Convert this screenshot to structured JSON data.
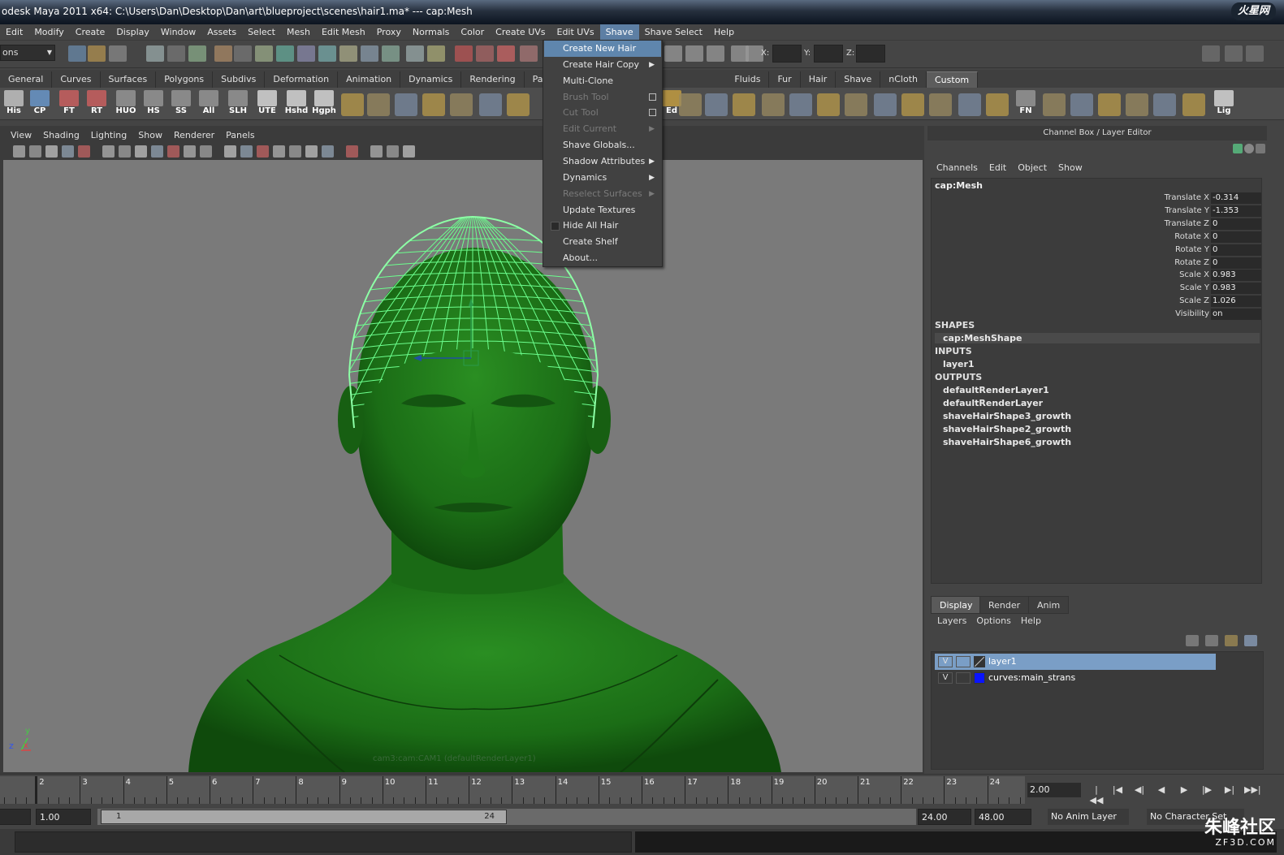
{
  "window": {
    "title": "odesk Maya 2011 x64: C:\\Users\\Dan\\Desktop\\Dan\\art\\blueproject\\scenes\\hair1.ma*  ---  cap:Mesh",
    "logo": "火星网"
  },
  "menubar": [
    "Edit",
    "Modify",
    "Create",
    "Display",
    "Window",
    "Assets",
    "Select",
    "Mesh",
    "Edit Mesh",
    "Proxy",
    "Normals",
    "Color",
    "Create UVs",
    "Edit UVs",
    "Shave",
    "Shave Select",
    "Help"
  ],
  "statusline": {
    "menuset": "ons",
    "x_label": "X:",
    "y_label": "Y:",
    "z_label": "Z:"
  },
  "shelf_tabs": [
    "General",
    "Curves",
    "Surfaces",
    "Polygons",
    "Subdivs",
    "Deformation",
    "Animation",
    "Dynamics",
    "Rendering",
    "PaintEff",
    "Fluids",
    "Fur",
    "Hair",
    "Shave",
    "nCloth",
    "Custom"
  ],
  "shelf_active_tab": "Custom",
  "shelf_labels": [
    "His",
    "CP",
    "FT",
    "RT",
    "HUO",
    "HS",
    "SS",
    "All",
    "SLH",
    "UTE",
    "Hshd",
    "Hgph",
    "Ed",
    "FN",
    "Lig"
  ],
  "shave_menu": {
    "items": [
      {
        "label": "Create New Hair",
        "state": "highlight"
      },
      {
        "label": "Create Hair Copy",
        "submenu": true
      },
      {
        "label": "Multi-Clone"
      },
      {
        "label": "Brush Tool",
        "state": "disabled",
        "option_box": true
      },
      {
        "label": "Cut Tool",
        "state": "disabled",
        "option_box": true
      },
      {
        "label": "Edit Current",
        "state": "disabled",
        "submenu": true
      },
      {
        "label": "Shave Globals..."
      },
      {
        "label": "Shadow Attributes",
        "submenu": true
      },
      {
        "label": "Dynamics",
        "submenu": true
      },
      {
        "label": "Reselect Surfaces",
        "state": "disabled",
        "submenu": true
      },
      {
        "label": "Update Textures"
      },
      {
        "label": "Hide All Hair",
        "checkbox": true
      },
      {
        "label": "Create Shelf"
      },
      {
        "label": "About..."
      }
    ]
  },
  "viewport": {
    "menu": [
      "View",
      "Shading",
      "Lighting",
      "Show",
      "Renderer",
      "Panels"
    ],
    "camera_caption": "cam3:cam:CAM1 (defaultRenderLayer1)",
    "axis_z": "z",
    "axis_x": "x",
    "axis_y": "y"
  },
  "channel_box": {
    "header": "Channel Box / Layer Editor",
    "menu": [
      "Channels",
      "Edit",
      "Object",
      "Show"
    ],
    "object": "cap:Mesh",
    "attributes": [
      {
        "name": "Translate X",
        "value": "-0.314"
      },
      {
        "name": "Translate Y",
        "value": "-1.353"
      },
      {
        "name": "Translate Z",
        "value": "0"
      },
      {
        "name": "Rotate X",
        "value": "0"
      },
      {
        "name": "Rotate Y",
        "value": "0"
      },
      {
        "name": "Rotate Z",
        "value": "0"
      },
      {
        "name": "Scale X",
        "value": "0.983"
      },
      {
        "name": "Scale Y",
        "value": "0.983"
      },
      {
        "name": "Scale Z",
        "value": "1.026"
      },
      {
        "name": "Visibility",
        "value": "on"
      }
    ],
    "shapes_label": "SHAPES",
    "shapes": [
      "cap:MeshShape"
    ],
    "inputs_label": "INPUTS",
    "inputs": [
      "layer1"
    ],
    "outputs_label": "OUTPUTS",
    "outputs": [
      "defaultRenderLayer1",
      "defaultRenderLayer",
      "shaveHairShape3_growth",
      "shaveHairShape2_growth",
      "shaveHairShape6_growth"
    ]
  },
  "layer_editor": {
    "tabs": [
      "Display",
      "Render",
      "Anim"
    ],
    "active_tab": "Display",
    "menu": [
      "Layers",
      "Options",
      "Help"
    ],
    "layers": [
      {
        "v": "V",
        "name": "layer1",
        "color": "",
        "selected": true
      },
      {
        "v": "V",
        "name": "curves:main_strans",
        "color": "#0a14ff",
        "selected": false
      }
    ]
  },
  "timeline": {
    "ticks": [
      "2",
      "3",
      "4",
      "5",
      "6",
      "7",
      "8",
      "9",
      "10",
      "11",
      "12",
      "13",
      "14",
      "15",
      "16",
      "17",
      "18",
      "19",
      "20",
      "21",
      "22",
      "23",
      "24"
    ],
    "current_frame": "2.00"
  },
  "range": {
    "start": "1.00",
    "handle_start": "1",
    "handle_end": "24",
    "end": "24.00",
    "max": "48.00",
    "anim_layer": "No Anim Layer",
    "character": "No Character Set"
  },
  "watermark": {
    "text": "朱峰社区",
    "sub": "ZF3D.COM"
  },
  "colors": {
    "accent": "#5f86ad",
    "mesh": "#1e7a1a",
    "wire": "#6cff8e"
  }
}
